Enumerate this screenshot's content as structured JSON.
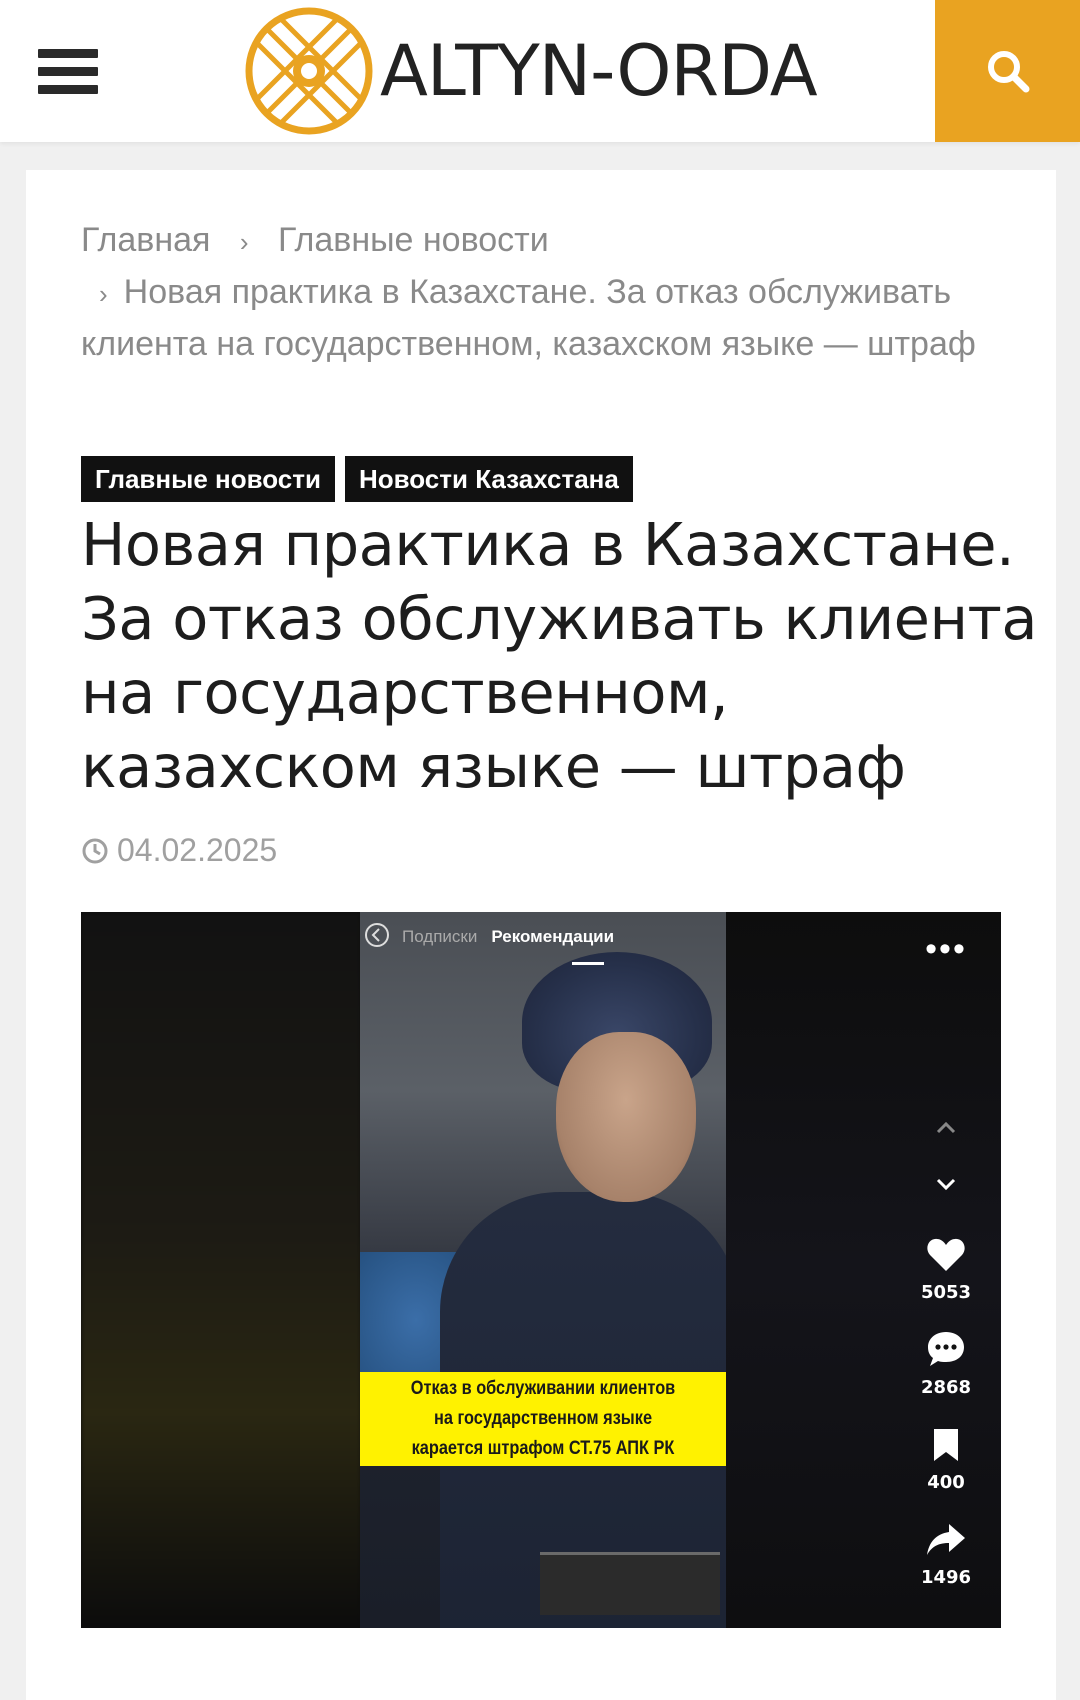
{
  "header": {
    "logo_text": "ALTYN-ORDA",
    "menu_icon": "hamburger-menu-icon",
    "search_icon": "search-icon",
    "accent_color": "#e9a321"
  },
  "breadcrumb": {
    "home": "Главная",
    "section": "Главные новости",
    "current": "Новая практика в Казахстане. За отказ обслуживать клиента на государственном, казахском языке — штраф",
    "separator": "›"
  },
  "tags": [
    "Главные новости",
    "Новости Казахстана"
  ],
  "article": {
    "title": "Новая практика в Казахстане. За отказ обслуживать клиента на государственном, казахском языке — штраф",
    "date": "04.02.2025"
  },
  "video": {
    "tab_subscriptions": "Подписки",
    "tab_recommendations": "Рекомендации",
    "caption_line1": "Отказ в обслуживании клиентов",
    "caption_line2": "на государственном языке",
    "caption_line3": "карается штрафом СТ.75 АПК РК",
    "likes": "5053",
    "comments": "2868",
    "saves": "400",
    "shares": "1496"
  }
}
